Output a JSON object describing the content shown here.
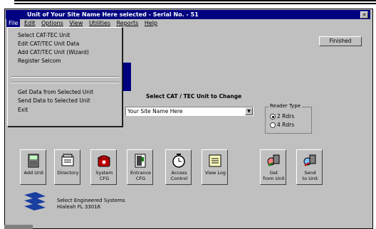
{
  "window": {
    "title": "Unit of Your Site Name Here selected - Serial No. - 51"
  },
  "menubar": [
    "File",
    "Edit",
    "Options",
    "View",
    "Utilities",
    "Reports",
    "Help"
  ],
  "dropdown": {
    "items": [
      "Select CAT-TEC Unit",
      "Edit CAT/TEC Unit Data",
      "Add CAT/TEC Unit (Wizard)",
      "Register Selcom"
    ],
    "items2": [
      "Get Data from Selected Unit",
      "Send Data  to  Selected Unit",
      "Exit"
    ]
  },
  "finished_label": "Finished",
  "select_label": "Select CAT / TEC Unit to Change",
  "combo_value": "Your Site Name Here",
  "reader_type": {
    "label": "Reader Type",
    "options": [
      "2 Rdrs",
      "4 Rdrs"
    ],
    "selected": "2 Rdrs"
  },
  "toolbar": [
    {
      "icon": "add-unit-icon",
      "label": "Add Unit"
    },
    {
      "icon": "directory-icon",
      "label": "Directory"
    },
    {
      "icon": "phone-icon",
      "label": "System\nCFG"
    },
    {
      "icon": "door-icon",
      "label": "Entrance\nCFG"
    },
    {
      "icon": "clock-icon",
      "label": "Access\nControl"
    },
    {
      "icon": "log-icon",
      "label": "View Log"
    },
    {
      "icon": "get-icon",
      "label": "Get\nfrom Unit"
    },
    {
      "icon": "send-icon",
      "label": "Send\nto Unit"
    }
  ],
  "company": {
    "line1": "Select Engineered Systems",
    "line2": "Hialeah FL 33016"
  },
  "colors": {
    "titlebar": "#000080",
    "face": "#c0c0c0"
  }
}
